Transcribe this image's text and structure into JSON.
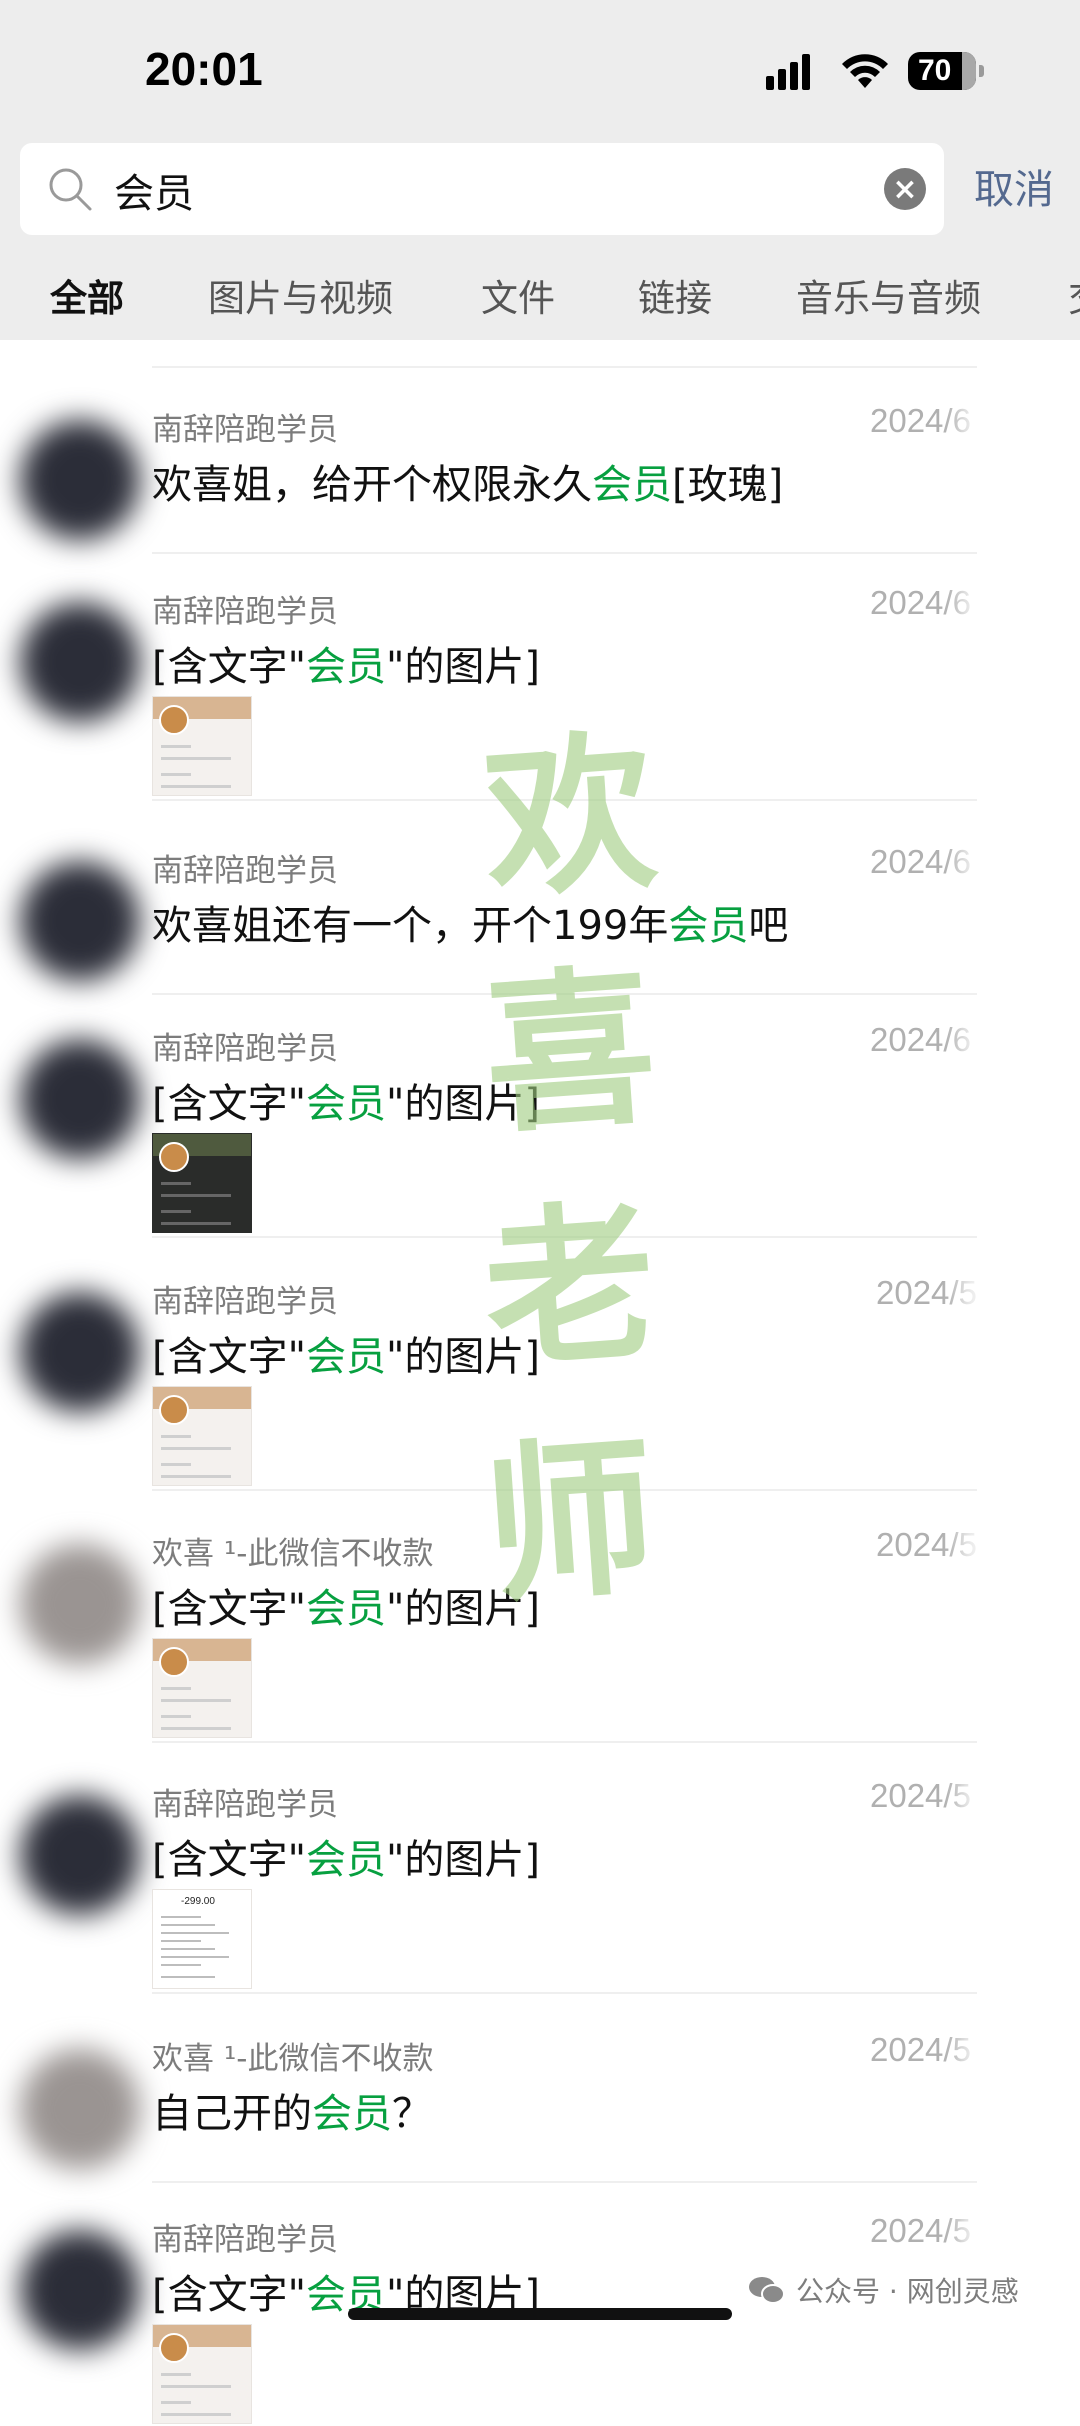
{
  "status_bar": {
    "time": "20:01",
    "battery": "70"
  },
  "search": {
    "query": "会员",
    "cancel_label": "取消"
  },
  "tabs": [
    {
      "label": "全部",
      "active": true
    },
    {
      "label": "图片与视频"
    },
    {
      "label": "文件"
    },
    {
      "label": "链接"
    },
    {
      "label": "音乐与音频"
    },
    {
      "label": "交"
    }
  ],
  "results": [
    {
      "sender": "南辞陪跑学员",
      "date": "2024/6",
      "pre": "欢喜姐，给开个权限永久",
      "hl": "会员",
      "post": "[玫瑰]",
      "thumb": null,
      "avatar": "dark"
    },
    {
      "sender": "南辞陪跑学员",
      "date": "2024/6",
      "pre": "[含文字\"",
      "hl": "会员",
      "post": "\"的图片]",
      "thumb": "light",
      "avatar": "dark"
    },
    {
      "sender": "南辞陪跑学员",
      "date": "2024/6",
      "pre": "欢喜姐还有一个，开个199年",
      "hl": "会员",
      "post": "吧",
      "thumb": null,
      "avatar": "dark"
    },
    {
      "sender": "南辞陪跑学员",
      "date": "2024/6",
      "pre": "[含文字\"",
      "hl": "会员",
      "post": "\"的图片]",
      "thumb": "dark",
      "avatar": "dark"
    },
    {
      "sender": "南辞陪跑学员",
      "date": "2024/5",
      "pre": "[含文字\"",
      "hl": "会员",
      "post": "\"的图片]",
      "thumb": "light",
      "avatar": "dark"
    },
    {
      "sender": "欢喜 ¹-此微信不收款",
      "date": "2024/5",
      "pre": "[含文字\"",
      "hl": "会员",
      "post": "\"的图片]",
      "thumb": "light",
      "avatar": "gray"
    },
    {
      "sender": "南辞陪跑学员",
      "date": "2024/5",
      "pre": "[含文字\"",
      "hl": "会员",
      "post": "\"的图片]",
      "thumb": "receipt",
      "thumb_amount": "-299.00",
      "avatar": "dark"
    },
    {
      "sender": "欢喜 ¹-此微信不收款",
      "date": "2024/5",
      "pre": "自己开的",
      "hl": "会员",
      "post": "？",
      "thumb": null,
      "avatar": "gray"
    },
    {
      "sender": "南辞陪跑学员",
      "date": "2024/5",
      "pre": "[含文字\"",
      "hl": "会员",
      "post": "\"的图片]",
      "thumb": "light",
      "avatar": "dark"
    }
  ],
  "watermark": [
    "欢",
    "喜",
    "老",
    "师"
  ],
  "footer": {
    "brand": "公众号 · 网创灵感"
  }
}
